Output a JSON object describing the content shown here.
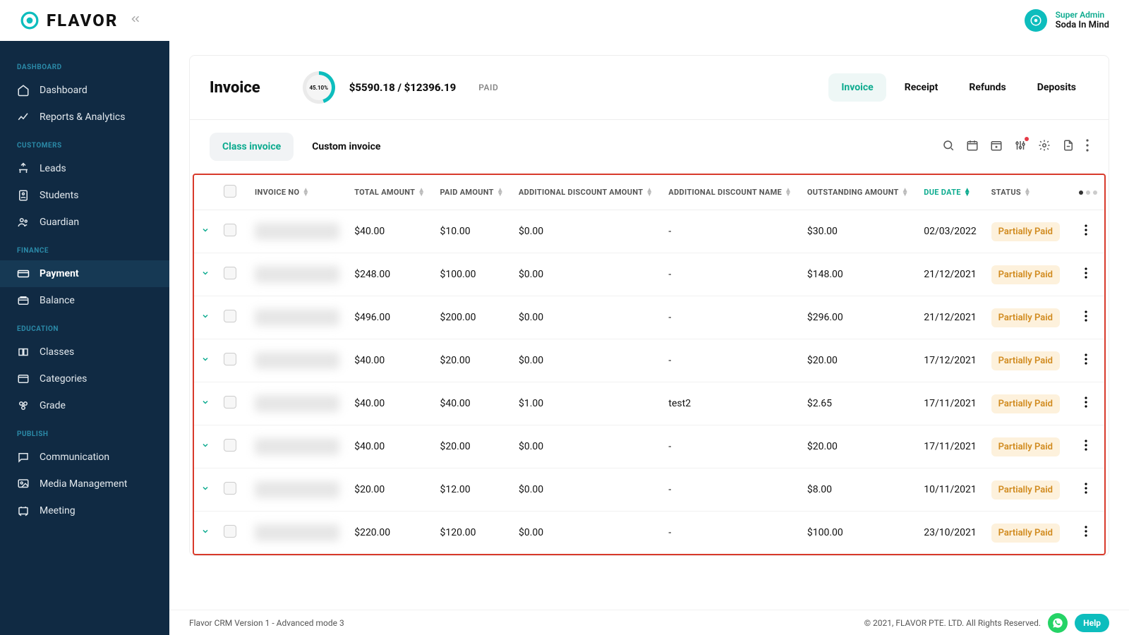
{
  "brand": "FLAVOR",
  "user": {
    "role": "Super Admin",
    "name": "Soda In Mind"
  },
  "sidebar": {
    "sections": [
      {
        "label": "DASHBOARD",
        "items": [
          "Dashboard",
          "Reports & Analytics"
        ]
      },
      {
        "label": "CUSTOMERS",
        "items": [
          "Leads",
          "Students",
          "Guardian"
        ]
      },
      {
        "label": "FINANCE",
        "items": [
          "Payment",
          "Balance"
        ],
        "active": "Payment"
      },
      {
        "label": "EDUCATION",
        "items": [
          "Classes",
          "Categories",
          "Grade"
        ]
      },
      {
        "label": "PUBLISH",
        "items": [
          "Communication",
          "Media Management",
          "Meeting"
        ]
      }
    ]
  },
  "page": {
    "title": "Invoice",
    "gauge_percent": "45.10%",
    "summary_paid": "$5590.18",
    "summary_total": "$12396.19",
    "paid_label": "PAID",
    "top_tabs": [
      "Invoice",
      "Receipt",
      "Refunds",
      "Deposits"
    ],
    "top_tab_active": "Invoice",
    "sub_tabs": [
      "Class invoice",
      "Custom invoice"
    ],
    "sub_tab_active": "Class invoice"
  },
  "table": {
    "columns": [
      "INVOICE NO",
      "TOTAL AMOUNT",
      "PAID AMOUNT",
      "ADDITIONAL DISCOUNT AMOUNT",
      "ADDITIONAL DISCOUNT NAME",
      "OUTSTANDING AMOUNT",
      "DUE DATE",
      "STATUS"
    ],
    "sort_active": "DUE DATE",
    "rows": [
      {
        "total": "$40.00",
        "paid": "$10.00",
        "add_disc_amt": "$0.00",
        "add_disc_name": "-",
        "outstanding": "$30.00",
        "due": "02/03/2022",
        "status": "Partially Paid"
      },
      {
        "total": "$248.00",
        "paid": "$100.00",
        "add_disc_amt": "$0.00",
        "add_disc_name": "-",
        "outstanding": "$148.00",
        "due": "21/12/2021",
        "status": "Partially Paid"
      },
      {
        "total": "$496.00",
        "paid": "$200.00",
        "add_disc_amt": "$0.00",
        "add_disc_name": "-",
        "outstanding": "$296.00",
        "due": "21/12/2021",
        "status": "Partially Paid"
      },
      {
        "total": "$40.00",
        "paid": "$20.00",
        "add_disc_amt": "$0.00",
        "add_disc_name": "-",
        "outstanding": "$20.00",
        "due": "17/12/2021",
        "status": "Partially Paid"
      },
      {
        "total": "$40.00",
        "paid": "$40.00",
        "add_disc_amt": "$1.00",
        "add_disc_name": "test2",
        "outstanding": "$2.65",
        "due": "17/11/2021",
        "status": "Partially Paid"
      },
      {
        "total": "$40.00",
        "paid": "$20.00",
        "add_disc_amt": "$0.00",
        "add_disc_name": "-",
        "outstanding": "$20.00",
        "due": "17/11/2021",
        "status": "Partially Paid"
      },
      {
        "total": "$20.00",
        "paid": "$12.00",
        "add_disc_amt": "$0.00",
        "add_disc_name": "-",
        "outstanding": "$8.00",
        "due": "10/11/2021",
        "status": "Partially Paid"
      },
      {
        "total": "$220.00",
        "paid": "$120.00",
        "add_disc_amt": "$0.00",
        "add_disc_name": "-",
        "outstanding": "$100.00",
        "due": "23/10/2021",
        "status": "Partially Paid"
      }
    ]
  },
  "footer": {
    "left": "Flavor CRM Version 1 - Advanced mode 3",
    "right": "© 2021, FLAVOR PTE. LTD. All Rights Reserved.",
    "help": "Help"
  }
}
